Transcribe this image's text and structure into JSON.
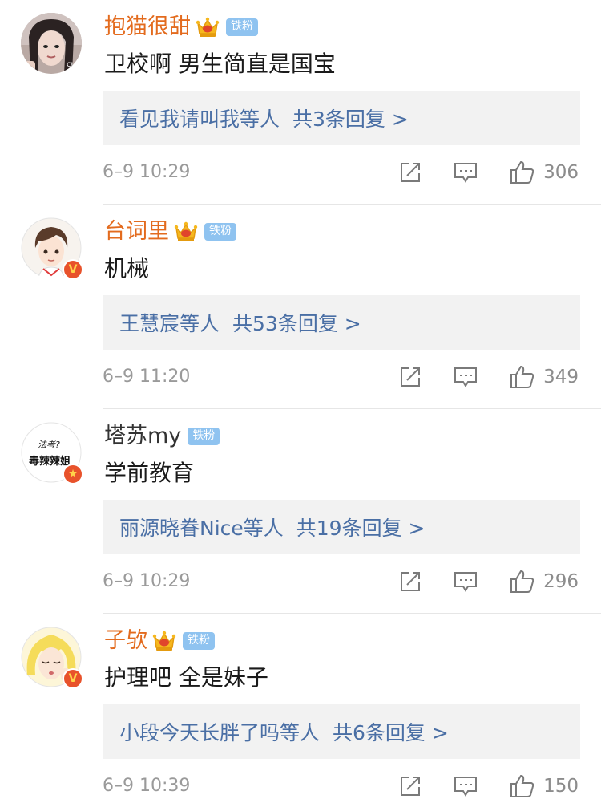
{
  "comments": [
    {
      "username": "抱猫很甜",
      "fan_badge": "铁粉",
      "text": "卫校啊 男生简直是国宝",
      "reply_users": "看见我请叫我等人",
      "reply_count": "共3条回复 >",
      "time": "6–9 10:29",
      "likes": "306",
      "avatar_overlay": "cu",
      "name_color": "#e36b1e"
    },
    {
      "username": "台词里",
      "fan_badge": "铁粉",
      "text": "机械",
      "reply_users": "王慧宸等人",
      "reply_count": "共53条回复 >",
      "time": "6–9 11:20",
      "likes": "349",
      "name_color": "#e36b1e"
    },
    {
      "username": "塔苏my",
      "fan_badge": "铁粉",
      "text": "学前教育",
      "reply_users": "丽源晓眷Nice等人",
      "reply_count": "共19条回复 >",
      "time": "6–9 10:29",
      "likes": "296",
      "avatar_text_top": "法考?",
      "avatar_text_bottom": "毒辣辣姐",
      "name_color": "#333333"
    },
    {
      "username": "子欤",
      "fan_badge": "铁粉",
      "text": "护理吧 全是妹子",
      "reply_users": "小段今天长胖了吗等人",
      "reply_count": "共6条回复 >",
      "time": "6–9 10:39",
      "likes": "150",
      "name_color": "#e36b1e"
    }
  ],
  "icons": {
    "crown": "crown-icon",
    "verified": "verified-v-badge",
    "share": "share-icon",
    "reply": "comment-icon",
    "like": "thumbs-up-icon"
  },
  "colors": {
    "vip_name": "#e36b1e",
    "reply_link": "#4a6fa5",
    "fan_badge": "#8fc3f0",
    "verified_badge": "#e8522b"
  }
}
